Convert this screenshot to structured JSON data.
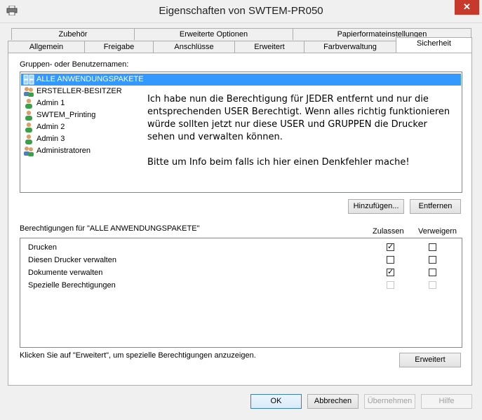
{
  "window": {
    "title": "Eigenschaften von SWTEM-PR050",
    "close_glyph": "✕"
  },
  "tabs_row1": [
    "Zubehör",
    "Erweiterte Optionen",
    "Papierformateinstellungen"
  ],
  "tabs_row2": [
    "Allgemein",
    "Freigabe",
    "Anschlüsse",
    "Erweitert",
    "Farbverwaltung",
    "Sicherheit"
  ],
  "active_tab": "Sicherheit",
  "groups": {
    "label": "Gruppen- oder Benutzernamen:",
    "items": [
      {
        "name": "ALLE ANWENDUNGSPAKETE",
        "icon": "package-group-icon",
        "selected": true
      },
      {
        "name": "ERSTELLER-BESITZER",
        "icon": "group-icon"
      },
      {
        "name": "Admin  1",
        "icon": "user-icon"
      },
      {
        "name": "SWTEM_Printing",
        "icon": "user-icon"
      },
      {
        "name": "Admin  2",
        "icon": "user-icon"
      },
      {
        "name": "Admin  3",
        "icon": "user-icon"
      },
      {
        "name": "Administratoren",
        "icon": "group-icon"
      }
    ],
    "add_button": "Hinzufügen...",
    "remove_button": "Entfernen"
  },
  "overlay_text": {
    "paragraph1": "Ich habe nun die Berechtigung für JEDER entfernt und nur die entsprechenden USER Berechtigt. Wenn alles richtig funktionieren würde sollten jetzt nur diese USER und GRUPPEN die Drucker sehen und verwalten können.",
    "paragraph2": "Bitte um Info beim falls ich hier einen Denkfehler mache!"
  },
  "permissions": {
    "label": "Berechtigungen für \"ALLE ANWENDUNGSPAKETE\"",
    "col_allow": "Zulassen",
    "col_deny": "Verweigern",
    "rows": [
      {
        "name": "Drucken",
        "allow": true,
        "deny": false,
        "enabled": true
      },
      {
        "name": "Diesen Drucker verwalten",
        "allow": false,
        "deny": false,
        "enabled": true
      },
      {
        "name": "Dokumente verwalten",
        "allow": true,
        "deny": false,
        "enabled": true
      },
      {
        "name": "Spezielle Berechtigungen",
        "allow": false,
        "deny": false,
        "enabled": false
      }
    ]
  },
  "advanced": {
    "hint": "Klicken Sie auf \"Erweitert\", um spezielle Berechtigungen anzuzeigen.",
    "button": "Erweitert"
  },
  "footer": {
    "ok": "OK",
    "cancel": "Abbrechen",
    "apply": "Übernehmen",
    "help": "Hilfe"
  }
}
